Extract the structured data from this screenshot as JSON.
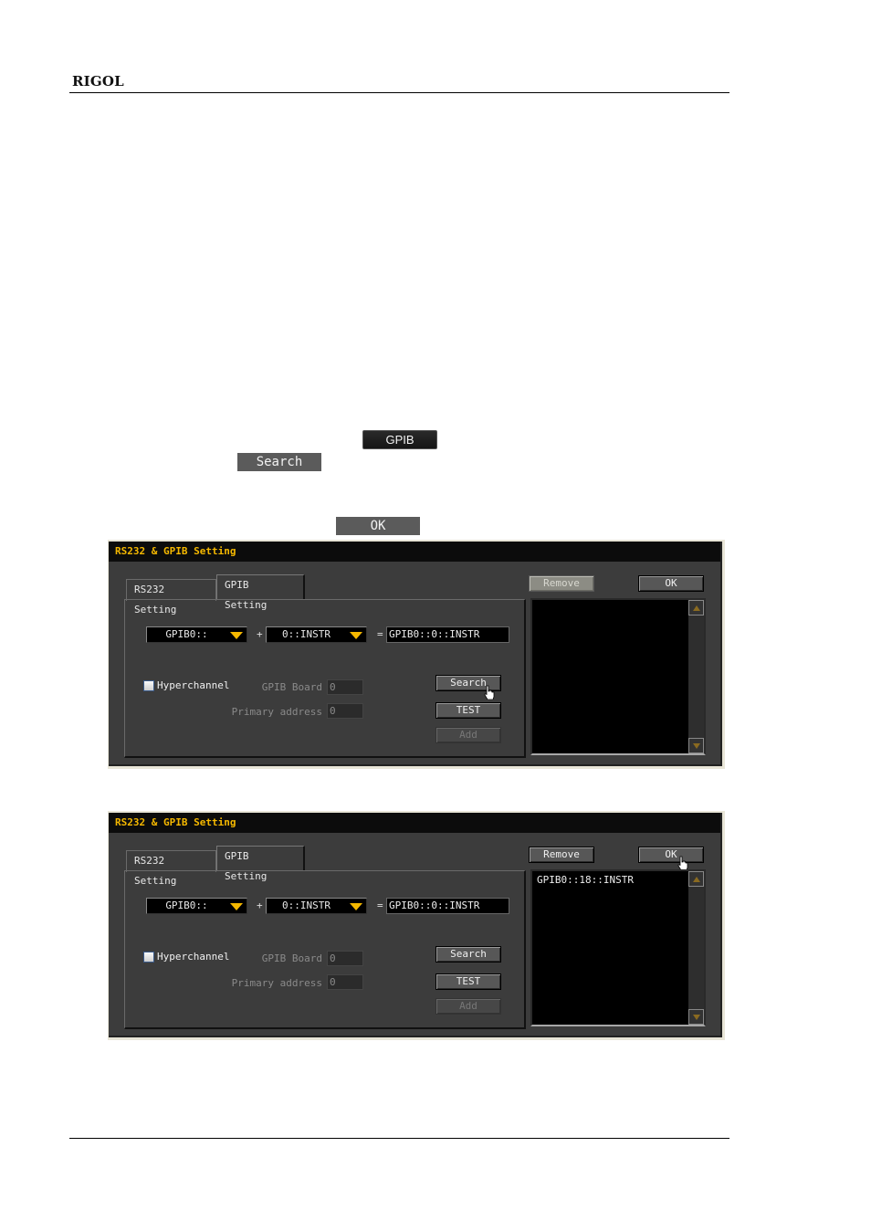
{
  "header": {
    "brand": "RIGOL"
  },
  "inline_buttons": {
    "gpib": "GPIB",
    "search": "Search",
    "ok": "OK"
  },
  "dialogs": [
    {
      "title": "RS232 & GPIB Setting",
      "tabs": [
        "RS232 Setting",
        "GPIB Setting"
      ],
      "active_tab": "GPIB Setting",
      "combo_board": "GPIB0::",
      "plus": "+",
      "combo_resource": "0::INSTR",
      "equals": "=",
      "result": "GPIB0::0::INSTR",
      "hyperchannel_label": "Hyperchannel",
      "hyperchannel_checked": false,
      "gpib_board_label": "GPIB Board",
      "gpib_board_value": "0",
      "primary_address_label": "Primary address",
      "primary_address_value": "0",
      "buttons": {
        "remove": "Remove",
        "ok": "OK",
        "search": "Search",
        "test": "TEST",
        "add": "Add"
      },
      "list_items": []
    },
    {
      "title": "RS232 & GPIB Setting",
      "tabs": [
        "RS232 Setting",
        "GPIB Setting"
      ],
      "active_tab": "GPIB Setting",
      "combo_board": "GPIB0::",
      "plus": "+",
      "combo_resource": "0::INSTR",
      "equals": "=",
      "result": "GPIB0::0::INSTR",
      "hyperchannel_label": "Hyperchannel",
      "hyperchannel_checked": false,
      "gpib_board_label": "GPIB Board",
      "gpib_board_value": "0",
      "primary_address_label": "Primary address",
      "primary_address_value": "0",
      "buttons": {
        "remove": "Remove",
        "ok": "OK",
        "search": "Search",
        "test": "TEST",
        "add": "Add"
      },
      "list_items": [
        "GPIB0::18::INSTR"
      ]
    }
  ],
  "colors": {
    "title_accent": "#f5b800",
    "dialog_bg": "#3c3c3c"
  }
}
